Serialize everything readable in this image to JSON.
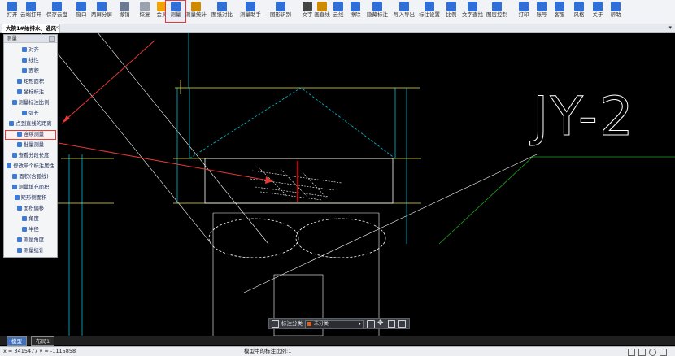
{
  "toolbar": {
    "items": [
      {
        "label": "打开",
        "icon": "open-icon",
        "color": "#2f6fd6"
      },
      {
        "label": "云端打开",
        "icon": "cloud-open-icon",
        "color": "#2f6fd6"
      },
      {
        "label": "保存云盘",
        "icon": "cloud-save-icon",
        "color": "#2f6fd6"
      },
      {
        "label": "窗口",
        "icon": "window-icon",
        "color": "#2f6fd6"
      },
      {
        "label": "两屏分屏",
        "icon": "split-screen-icon",
        "color": "#2f6fd6"
      },
      {
        "label": "撤销",
        "icon": "undo-icon",
        "color": "#6b7a90"
      },
      {
        "label": "恢复",
        "icon": "redo-icon",
        "color": "#9aa3ad"
      },
      {
        "label": "会员",
        "icon": "vip-icon",
        "color": "#f0a300"
      },
      {
        "label": "测量",
        "icon": "measure-icon",
        "color": "#2f6fd6"
      },
      {
        "label": "测量统计",
        "icon": "measure-stats-icon",
        "color": "#d08a00"
      },
      {
        "label": "图纸对比",
        "icon": "compare-icon",
        "color": "#2f6fd6"
      },
      {
        "label": "测量助手",
        "icon": "measure-assistant-icon",
        "color": "#2f6fd6"
      },
      {
        "label": "图形识别",
        "icon": "shape-recognize-icon",
        "color": "#2f6fd6"
      },
      {
        "label": "文字",
        "icon": "text-icon",
        "color": "#444444"
      },
      {
        "label": "画直线",
        "icon": "line-icon",
        "color": "#d08a00"
      },
      {
        "label": "云线",
        "icon": "revcloud-icon",
        "color": "#2f6fd6"
      },
      {
        "label": "擦除",
        "icon": "eraser-icon",
        "color": "#2f6fd6"
      },
      {
        "label": "隐藏标注",
        "icon": "hide-annotation-icon",
        "color": "#2f6fd6"
      },
      {
        "label": "导入导出",
        "icon": "import-export-icon",
        "color": "#2f6fd6"
      },
      {
        "label": "标注设置",
        "icon": "annotation-settings-icon",
        "color": "#2f6fd6"
      },
      {
        "label": "比例",
        "icon": "scale-icon",
        "color": "#2f6fd6"
      },
      {
        "label": "文字查找",
        "icon": "text-search-icon",
        "color": "#2f6fd6"
      },
      {
        "label": "图层控制",
        "icon": "layer-control-icon",
        "color": "#2f6fd6"
      },
      {
        "label": "打印",
        "icon": "print-icon",
        "color": "#2f6fd6"
      },
      {
        "label": "账号",
        "icon": "account-icon",
        "color": "#2f6fd6"
      },
      {
        "label": "客服",
        "icon": "support-icon",
        "color": "#2f6fd6"
      },
      {
        "label": "风格",
        "icon": "theme-icon",
        "color": "#2f6fd6"
      },
      {
        "label": "关于",
        "icon": "about-icon",
        "color": "#2f6fd6"
      },
      {
        "label": "帮助",
        "icon": "help-icon",
        "color": "#2f6fd6"
      }
    ]
  },
  "tab": {
    "title": "大院1#给排水、通风",
    "close": "×",
    "menu": "▾"
  },
  "panel": {
    "title": "测量",
    "items": [
      {
        "label": "对齐"
      },
      {
        "label": "线性"
      },
      {
        "label": "面积"
      },
      {
        "label": "矩形面积"
      },
      {
        "label": "坐标标注"
      },
      {
        "label": "测量标注比例"
      },
      {
        "label": "弧长"
      },
      {
        "label": "点到直线的距离"
      },
      {
        "label": "连续测量"
      },
      {
        "label": "批量测量"
      },
      {
        "label": "查看分段长度"
      },
      {
        "label": "修改单个标注属性"
      },
      {
        "label": "面积(含弧线)"
      },
      {
        "label": "测量填充面积"
      },
      {
        "label": "矩形侧面积"
      },
      {
        "label": "面积偏移"
      },
      {
        "label": "角度"
      },
      {
        "label": "半径"
      },
      {
        "label": "测量角度"
      },
      {
        "label": "测量统计"
      }
    ]
  },
  "drawing": {
    "title_text": "JY-2"
  },
  "floatbar": {
    "category_label": "标注分类",
    "category_value": "未分类"
  },
  "sheets": {
    "model": "模型",
    "layout": "布局1"
  },
  "status": {
    "coords": "x = 3415477  y = -1115858",
    "scale_text": "模型中的标注比例:1"
  },
  "colors": {
    "accent": "#e53935",
    "selection_red": "#ff0000",
    "cyan_line": "#00bcd4",
    "yellow_line": "#e6e64a",
    "green_line": "#1ea51e"
  }
}
